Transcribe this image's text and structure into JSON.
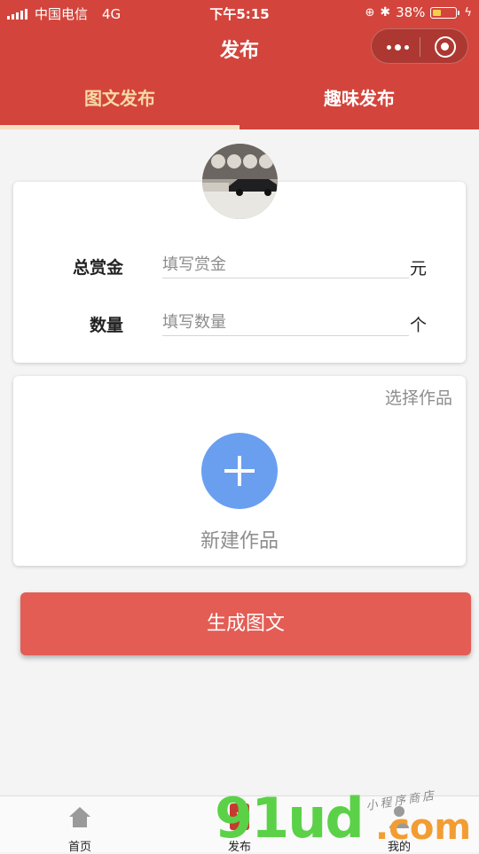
{
  "status_bar": {
    "carrier": "中国电信",
    "network": "4G",
    "time": "下午5:15",
    "battery": "38%",
    "battery_level": 0.38
  },
  "nav": {
    "title": "发布"
  },
  "tabs": [
    {
      "label": "图文发布",
      "active": true
    },
    {
      "label": "趣味发布",
      "active": false
    }
  ],
  "form": {
    "reward_label": "总赏金",
    "reward_placeholder": "填写赏金",
    "reward_unit": "元",
    "quantity_label": "数量",
    "quantity_placeholder": "填写数量",
    "quantity_unit": "个"
  },
  "works": {
    "select_label": "选择作品",
    "new_label": "新建作品"
  },
  "generate_button": "生成图文",
  "tabbar": [
    {
      "label": "首页",
      "icon": "home-icon"
    },
    {
      "label": "发布",
      "icon": "publish-icon"
    },
    {
      "label": "我的",
      "icon": "user-icon"
    }
  ],
  "watermark": {
    "main": "91ud",
    "suffix": ".com",
    "sub": "小程序商店"
  },
  "colors": {
    "header": "#d3453c",
    "active_tab": "#f6d9a5",
    "primary_button": "#e35d55",
    "add_button": "#6a9ff0"
  }
}
